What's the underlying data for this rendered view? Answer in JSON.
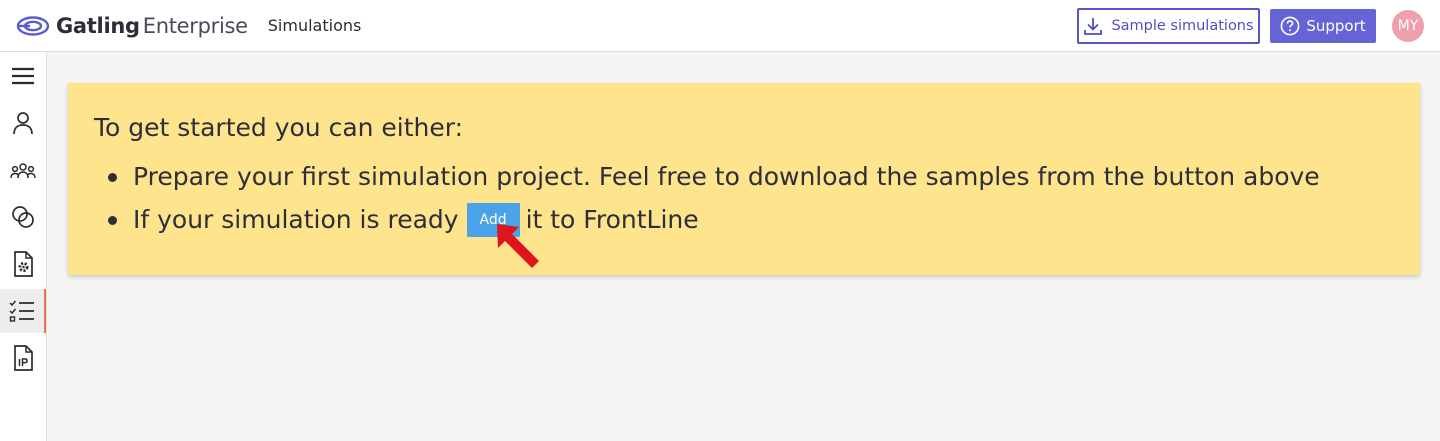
{
  "app": {
    "brand_bold": "Gatling",
    "brand_light": "Enterprise",
    "page_title": "Simulations"
  },
  "header": {
    "sample_label": "Sample simulations",
    "support_label": "Support",
    "avatar_initials": "MY"
  },
  "sidebar": {
    "items": [
      {
        "icon": "menu-icon"
      },
      {
        "icon": "user-icon"
      },
      {
        "icon": "teams-icon"
      },
      {
        "icon": "coins-icon"
      },
      {
        "icon": "settings-file-icon"
      },
      {
        "icon": "checklist-icon",
        "active": true
      },
      {
        "icon": "ip-file-icon"
      }
    ]
  },
  "banner": {
    "intro": "To get started you can either:",
    "item1": "Prepare your first simulation project. Feel free to download the samples from the button above",
    "item2_before": "If your simulation is ready",
    "add_label": "Add",
    "item2_after": "it to FrontLine"
  },
  "colors": {
    "accent": "#6464d6",
    "banner_bg": "#fee48d",
    "add_button": "#4aa2e8",
    "active_marker": "#e9734c",
    "annotation_arrow": "#e0141c"
  }
}
